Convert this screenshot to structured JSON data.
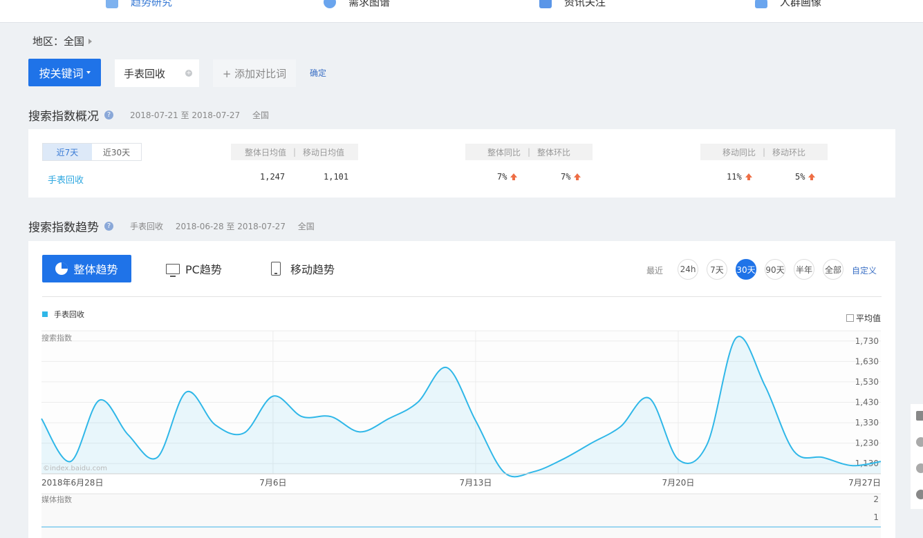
{
  "nav": {
    "items": [
      {
        "label": "趋势研究",
        "icon": "trend-icon",
        "active": true
      },
      {
        "label": "需求图谱",
        "icon": "location-pin-icon",
        "active": false
      },
      {
        "label": "资讯关注",
        "icon": "news-icon",
        "active": false
      },
      {
        "label": "人群画像",
        "icon": "user-icon",
        "active": false
      }
    ]
  },
  "region": {
    "label": "地区：",
    "value": "全国"
  },
  "search": {
    "mode_button": "按关键词",
    "keyword": "手表回收",
    "add_compare": "+ 添加对比词",
    "confirm": "确定"
  },
  "overview": {
    "title": "搜索指数概况",
    "date_range": "2018-07-21 至 2018-07-27",
    "region": "全国",
    "tabs": [
      "近7天",
      "近30天"
    ],
    "headers": {
      "avg_all": "整体日均值",
      "avg_mobile": "移动日均值",
      "yoy_all": "整体同比",
      "mom_all": "整体环比",
      "yoy_mobile": "移动同比",
      "mom_mobile": "移动环比"
    },
    "keyword": "手表回收",
    "values": {
      "avg_all": "1,247",
      "avg_mobile": "1,101",
      "yoy_all": "7%",
      "mom_all": "7%",
      "yoy_mobile": "11%",
      "mom_mobile": "5%"
    }
  },
  "trend": {
    "title": "搜索指数趋势",
    "keyword": "手表回收",
    "date_range": "2018-06-28 至 2018-07-27",
    "region": "全国",
    "tabs": [
      "整体趋势",
      "PC趋势",
      "移动趋势"
    ],
    "range_label": "最近",
    "ranges": [
      "24h",
      "7天",
      "30天",
      "90天",
      "半年",
      "全部"
    ],
    "active_range": "30天",
    "custom": "自定义",
    "legend": "手表回收",
    "avg_toggle": "平均值",
    "watermark": "©index.baidu.com",
    "media_label": "媒体指数",
    "accent": "#2fb7e8"
  },
  "chart_data": {
    "type": "area",
    "ylabel": "搜索指数",
    "yticks": [
      1130,
      1230,
      1330,
      1430,
      1530,
      1630,
      1730
    ],
    "ytick_labels": [
      "1,130",
      "1,230",
      "1,330",
      "1,430",
      "1,530",
      "1,630",
      "1,730"
    ],
    "ylim": [
      1080,
      1780
    ],
    "x": [
      "2018-06-28",
      "2018-06-29",
      "2018-06-30",
      "2018-07-01",
      "2018-07-02",
      "2018-07-03",
      "2018-07-04",
      "2018-07-05",
      "2018-07-06",
      "2018-07-07",
      "2018-07-08",
      "2018-07-09",
      "2018-07-10",
      "2018-07-11",
      "2018-07-12",
      "2018-07-13",
      "2018-07-14",
      "2018-07-15",
      "2018-07-16",
      "2018-07-17",
      "2018-07-18",
      "2018-07-19",
      "2018-07-20",
      "2018-07-21",
      "2018-07-22",
      "2018-07-23",
      "2018-07-24",
      "2018-07-25",
      "2018-07-26",
      "2018-07-27"
    ],
    "xtick_labels": [
      {
        "date": "2018-06-28",
        "label": "2018年6月28日"
      },
      {
        "date": "2018-07-06",
        "label": "7月6日"
      },
      {
        "date": "2018-07-13",
        "label": "7月13日"
      },
      {
        "date": "2018-07-20",
        "label": "7月20日"
      },
      {
        "date": "2018-07-27",
        "label": "7月27日"
      }
    ],
    "series": [
      {
        "name": "手表回收",
        "values": [
          1350,
          1140,
          1440,
          1270,
          1160,
          1480,
          1320,
          1280,
          1460,
          1360,
          1360,
          1285,
          1350,
          1430,
          1600,
          1340,
          1085,
          1090,
          1150,
          1230,
          1310,
          1450,
          1150,
          1225,
          1745,
          1510,
          1190,
          1160,
          1120,
          1140
        ]
      }
    ],
    "media": {
      "label": "媒体指数",
      "yticks": [
        "2",
        "1"
      ],
      "values_all_zero": true
    },
    "grid": true
  }
}
